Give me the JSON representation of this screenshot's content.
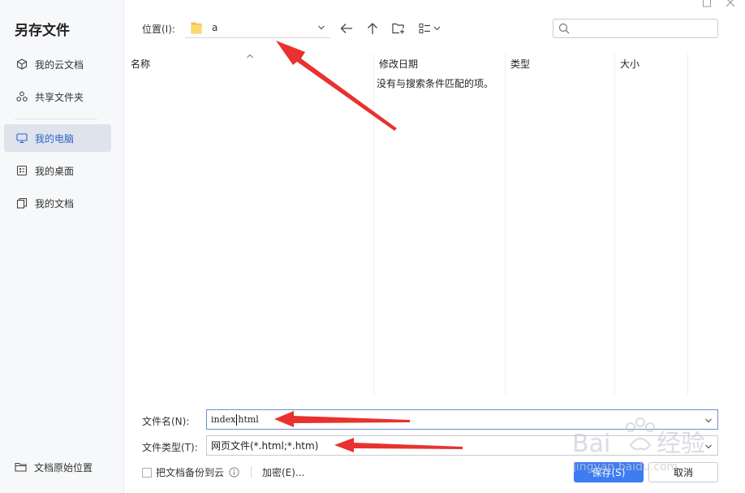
{
  "dialog": {
    "title": "另存文件"
  },
  "sidebar": {
    "items": [
      {
        "label": "我的云文档",
        "icon": "cloud-doc-icon"
      },
      {
        "label": "共享文件夹",
        "icon": "shared-folder-icon"
      },
      {
        "label": "我的电脑",
        "icon": "computer-icon",
        "active": true
      },
      {
        "label": "我的桌面",
        "icon": "desktop-icon"
      },
      {
        "label": "我的文档",
        "icon": "documents-icon"
      }
    ],
    "bottom": {
      "label": "文档原始位置",
      "icon": "folder-icon"
    }
  },
  "location": {
    "label": "位置(I):",
    "value": "a"
  },
  "columns": {
    "name": "名称",
    "modified": "修改日期",
    "type": "类型",
    "size": "大小"
  },
  "empty_message": "没有与搜索条件匹配的项。",
  "filename": {
    "label": "文件名(N):",
    "value_before_caret": "index",
    "value_after_caret": "html"
  },
  "filetype": {
    "label": "文件类型(T):",
    "value": "网页文件(*.html;*.htm)"
  },
  "options": {
    "backup_label": "把文档备份到云",
    "backup_checked": false,
    "encrypt_label": "加密(E)..."
  },
  "buttons": {
    "save": "保存(S)",
    "cancel": "取消"
  },
  "watermark": {
    "text": "jingyan.baidu.com"
  },
  "colors": {
    "accent": "#3d7cf1",
    "active_nav_bg": "#dfe3ec",
    "annotation_arrow": "#e8322f"
  }
}
